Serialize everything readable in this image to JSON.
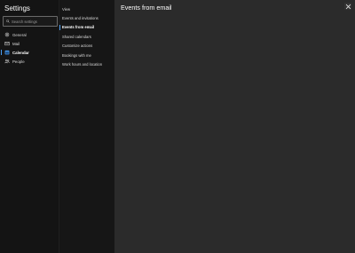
{
  "settings": {
    "title": "Settings",
    "search_placeholder": "Search settings",
    "nav": [
      {
        "label": "General",
        "icon": "gear-icon"
      },
      {
        "label": "Mail",
        "icon": "mail-icon"
      },
      {
        "label": "Calendar",
        "icon": "calendar-icon",
        "active": true
      },
      {
        "label": "People",
        "icon": "people-icon"
      }
    ]
  },
  "calendar_menu": {
    "items": [
      {
        "label": "View"
      },
      {
        "label": "Events and invitations"
      },
      {
        "label": "Events from email",
        "active": true
      },
      {
        "label": "Shared calendars"
      },
      {
        "label": "Customize actions"
      },
      {
        "label": "Bookings with me"
      },
      {
        "label": "Work hours and location"
      }
    ]
  },
  "main": {
    "title": "Events from email"
  },
  "colors": {
    "accent": "#4a9cf0",
    "background": "#2b2b2b",
    "sidebar": "#141414"
  }
}
